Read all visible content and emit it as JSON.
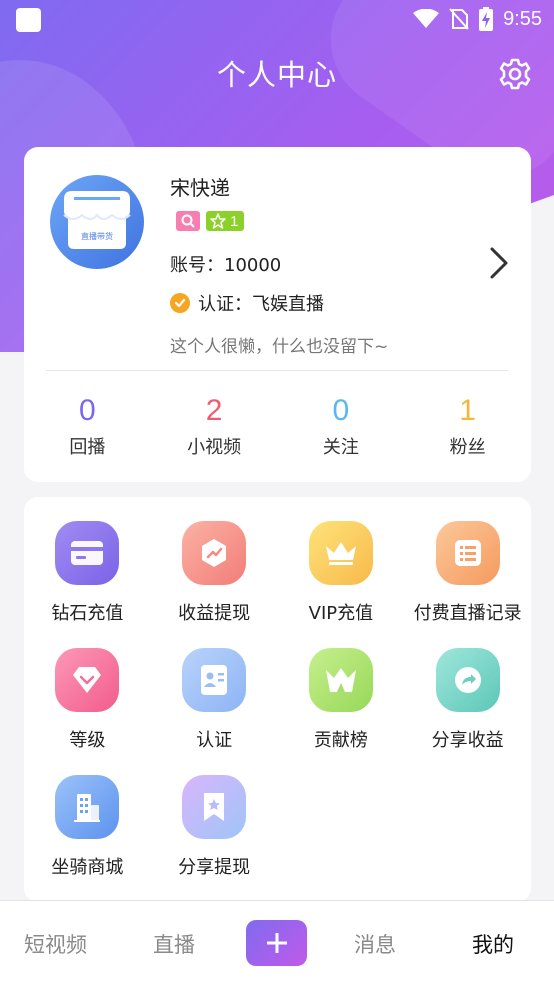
{
  "status": {
    "time": "9:55"
  },
  "header": {
    "title": "个人中心"
  },
  "profile": {
    "username": "宋快递",
    "level": "1",
    "account": "账号：10000",
    "verification": "认证：飞娱直播",
    "bio": "这个人很懒，什么也没留下~",
    "avatar_text": "直播带货"
  },
  "stats": [
    {
      "value": "0",
      "label": "回播",
      "color": "#7b68ee"
    },
    {
      "value": "2",
      "label": "小视频",
      "color": "#f25b6d"
    },
    {
      "value": "0",
      "label": "关注",
      "color": "#5ab8f0"
    },
    {
      "value": "1",
      "label": "粉丝",
      "color": "#f5b73b"
    }
  ],
  "functions": [
    {
      "label": "钻石充值",
      "icon": "card-icon"
    },
    {
      "label": "收益提现",
      "icon": "chart-icon"
    },
    {
      "label": "VIP充值",
      "icon": "crown-icon"
    },
    {
      "label": "付费直播记录",
      "icon": "list-icon"
    },
    {
      "label": "等级",
      "icon": "gem-icon"
    },
    {
      "label": "认证",
      "icon": "id-card-icon"
    },
    {
      "label": "贡献榜",
      "icon": "rank-crown-icon"
    },
    {
      "label": "分享收益",
      "icon": "share-icon"
    },
    {
      "label": "坐骑商城",
      "icon": "building-icon"
    },
    {
      "label": "分享提现",
      "icon": "bookmark-icon"
    }
  ],
  "nav": {
    "short_video": "短视频",
    "live": "直播",
    "messages": "消息",
    "mine": "我的"
  }
}
